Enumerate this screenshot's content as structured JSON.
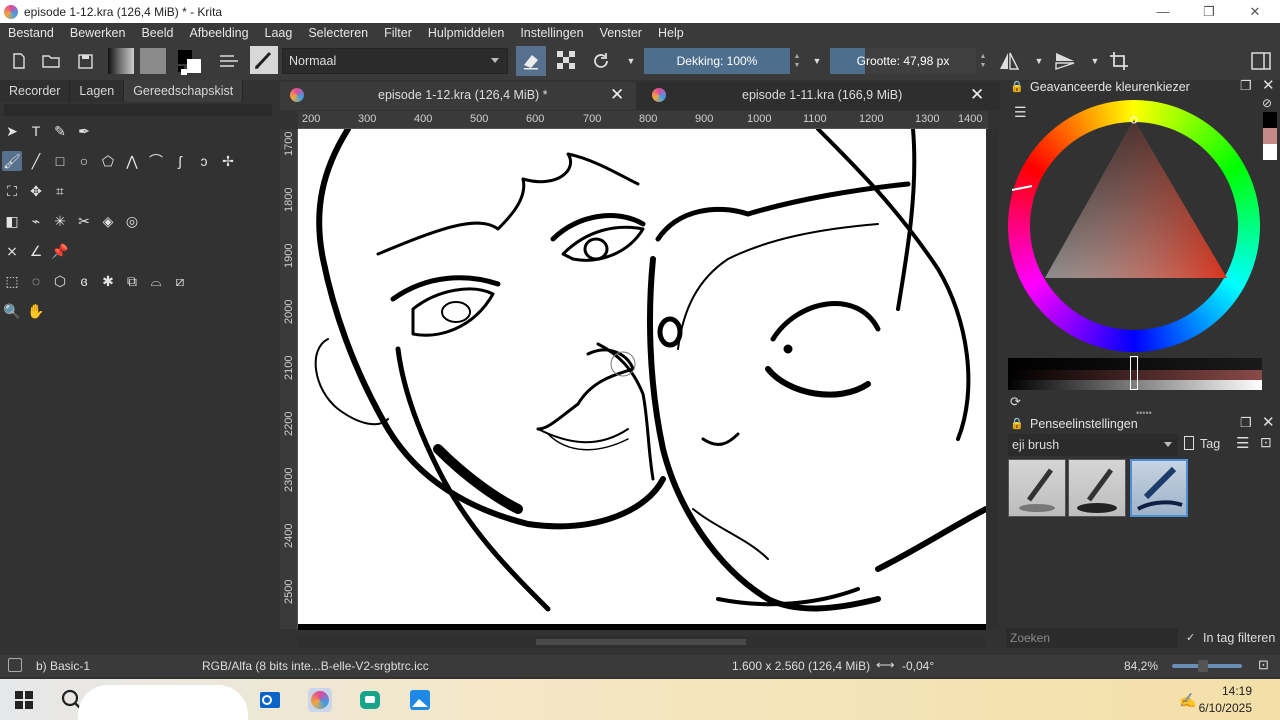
{
  "window": {
    "title": "episode 1-12.kra (126,4 MiB) * - Krita"
  },
  "menu": [
    "Bestand",
    "Bewerken",
    "Beeld",
    "Afbeelding",
    "Laag",
    "Selecteren",
    "Filter",
    "Hulpmiddelen",
    "Instellingen",
    "Venster",
    "Help"
  ],
  "toolbar": {
    "blend_mode": "Normaal",
    "opacity_label": "Dekking: 100%",
    "size_label": "Grootte: 47,98 px"
  },
  "left_dock": {
    "tabs": [
      "Recorder",
      "Lagen",
      "Gereedschapskist"
    ],
    "active_tab": "Gereedschapskist"
  },
  "documents": [
    {
      "title": "episode 1-12.kra (126,4 MiB) *",
      "active": true
    },
    {
      "title": "episode 1-11.kra (166,9 MiB)",
      "active": false
    }
  ],
  "ruler_h": [
    "200",
    "300",
    "400",
    "500",
    "600",
    "700",
    "800",
    "900",
    "1000",
    "1100",
    "1200",
    "1300",
    "1400"
  ],
  "ruler_v": [
    "1700",
    "1800",
    "1900",
    "2000",
    "2100",
    "2200",
    "2300",
    "2400",
    "2500"
  ],
  "color_panel": {
    "title": "Geavanceerde kleurenkiezer"
  },
  "brush_panel": {
    "title": "Penseelinstellingen",
    "preset": "eji brush",
    "tag_label": "Tag",
    "search_placeholder": "Zoeken",
    "filter_label": "In tag filteren"
  },
  "status": {
    "brush": "b) Basic-1",
    "color_profile": "RGB/Alfa (8 bits inte...B-elle-V2-srgbtrc.icc",
    "dimensions": "1.600 x 2.560 (126,4 MiB)",
    "rotation": "-0,04°",
    "zoom": "84,2%"
  },
  "taskbar": {
    "time": "14:19",
    "date": "6/10/2025"
  },
  "colors": {
    "accent": "#4e6e8e",
    "panel": "#323232",
    "selected": "#56708d"
  }
}
